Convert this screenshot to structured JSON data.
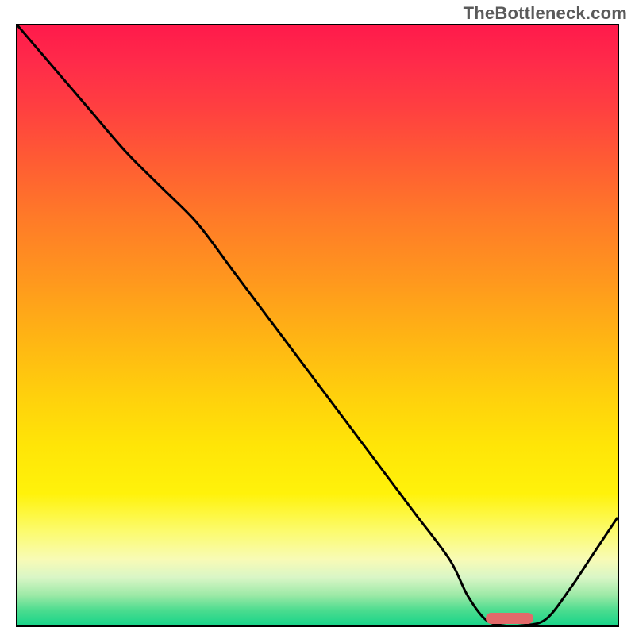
{
  "watermark": "TheBottleneck.com",
  "colors": {
    "curve": "#000000",
    "marker": "#e26a6a",
    "border": "#000000"
  },
  "chart_data": {
    "type": "line",
    "title": "",
    "xlabel": "",
    "ylabel": "",
    "xlim": [
      0,
      100
    ],
    "ylim": [
      0,
      100
    ],
    "grid": false,
    "series": [
      {
        "name": "bottleneck-curve",
        "x": [
          0,
          6,
          12,
          18,
          24,
          30,
          36,
          42,
          48,
          54,
          60,
          66,
          72,
          75,
          78,
          81,
          84,
          88,
          92,
          96,
          100
        ],
        "y": [
          100,
          93,
          86,
          79,
          73,
          67,
          59,
          51,
          43,
          35,
          27,
          19,
          11,
          5,
          1,
          0,
          0,
          1,
          6,
          12,
          18
        ]
      }
    ],
    "optimal_range_pct": {
      "start": 78,
      "end": 86
    }
  }
}
